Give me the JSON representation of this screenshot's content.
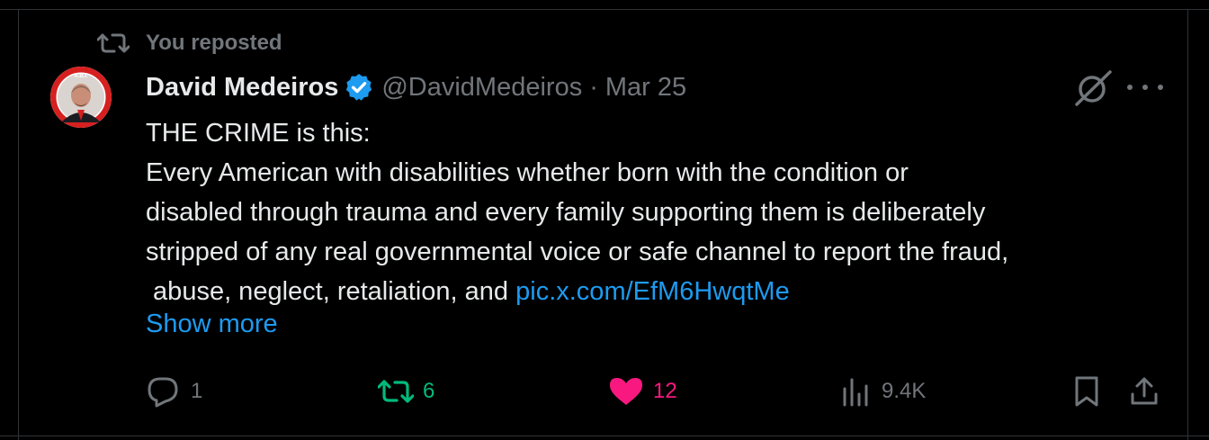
{
  "repost_label": "You reposted",
  "author": {
    "name": "David Medeiros",
    "handle": "@DavidMedeiros",
    "separator": "·",
    "date": "Mar 25"
  },
  "tweet": {
    "lines": [
      "THE CRIME is this:",
      "Every American with disabilities  whether born with the condition or",
      "disabled through trauma and every family supporting them is deliberately",
      "stripped of any real governmental voice or safe channel to report the fraud,"
    ],
    "last_line_prefix": " abuse, neglect, retaliation, and ",
    "link": "pic.x.com/EfM6HwqtMe",
    "show_more": "Show more"
  },
  "stats": {
    "replies": "1",
    "reposts": "6",
    "likes": "12",
    "views": "9.4K"
  },
  "colors": {
    "background": "#000000",
    "text": "#e7e9ea",
    "muted": "#71767b",
    "link": "#1d9bf0",
    "repost_active": "#00ba7c",
    "like_active": "#f91880",
    "border": "#2f3336"
  },
  "icons": [
    "repost-icon",
    "verified-badge-icon",
    "grok-icon",
    "more-icon",
    "reply-icon",
    "heart-icon",
    "views-icon",
    "bookmark-icon",
    "share-icon"
  ]
}
